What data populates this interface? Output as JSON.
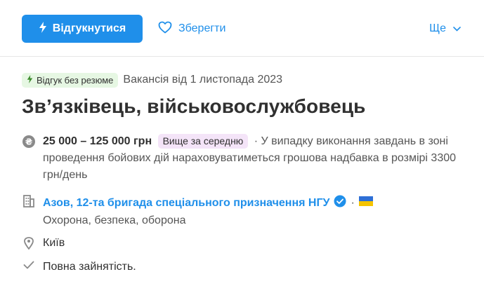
{
  "toolbar": {
    "apply_label": "Відгукнутися",
    "save_label": "Зберегти",
    "more_label": "Ще"
  },
  "meta": {
    "badge": "Відгук без резюме",
    "posted": "Вакансія від 1 листопада 2023"
  },
  "vacancy": {
    "title": "Зв’язківець, військовослужбовець"
  },
  "salary": {
    "amount": "25 000 – 125 000 грн",
    "badge": "Вище за середню",
    "separator": "·",
    "note": "У випадку виконання завдань в зоні проведення бойових дій нараховуватиметься грошова надбавка в розмірі 3300 грн/день"
  },
  "company": {
    "name": "Азов, 12-та бригада спеціального призначення НГУ",
    "separator": "·",
    "description": "Охорона, безпека, оборона"
  },
  "location": "Київ",
  "employment": "Повна зайнятість.",
  "colors": {
    "accent": "#1f8fea",
    "badge_green": "#e6f7e3",
    "badge_purple": "#f4e4f8"
  },
  "icons": [
    "lightning-icon",
    "heart-icon",
    "chevron-down-icon",
    "coin-icon",
    "building-icon",
    "verified-icon",
    "ukraine-flag-icon",
    "map-pin-icon",
    "checkmark-icon"
  ]
}
